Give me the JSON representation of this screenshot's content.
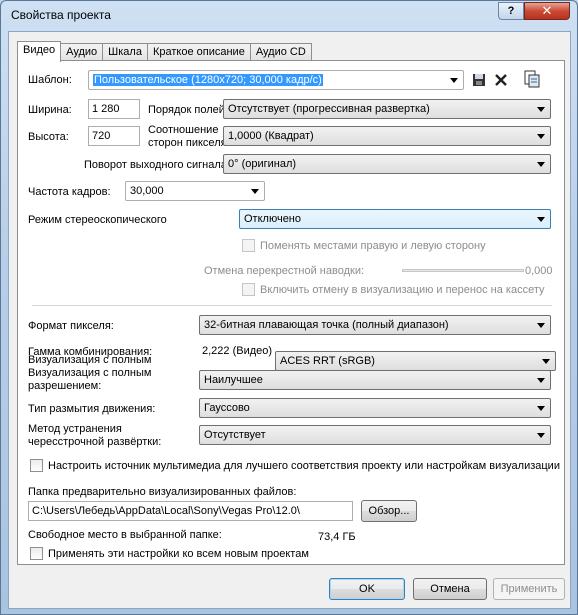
{
  "window": {
    "title": "Свойства проекта",
    "help": "?",
    "close": "✕"
  },
  "tabs": [
    "Видео",
    "Аудио",
    "Шкала",
    "Краткое описание",
    "Аудио CD"
  ],
  "template": {
    "label": "Шаблон:",
    "value": "Пользовательское (1280x720; 30,000 кадр/с)"
  },
  "width": {
    "label": "Ширина:",
    "value": "1 280"
  },
  "height": {
    "label": "Высота:",
    "value": "720"
  },
  "field_order": {
    "label": "Порядок полей:",
    "value": "Отсутствует (прогрессивная развертка)"
  },
  "pixel_aspect": {
    "label1": "Соотношение",
    "label2": "сторон пикселя:",
    "value": "1,0000 (Квадрат)"
  },
  "output_rotation": {
    "label": "Поворот выходного сигнала:",
    "value": "0° (оригинал)"
  },
  "frame_rate": {
    "label": "Частота кадров:",
    "value": "30,000"
  },
  "stereo_mode": {
    "label": "Режим стереоскопического",
    "value": "Отключено"
  },
  "swap_lr": {
    "label": "Поменять местами правую и левую сторону"
  },
  "crosstalk": {
    "label": "Отмена перекрестной наводки:",
    "value": "0,000"
  },
  "crosstalk_render": {
    "label": "Включить отмену в визуализацию и перенос на кассету"
  },
  "pixel_format": {
    "label": "Формат пикселя:",
    "value": "32-битная плавающая точка (полный диапазон)"
  },
  "compositing_gamma": {
    "label": "Гамма комбинирования:",
    "value": "2,222 (Видео)"
  },
  "view_transform": {
    "label": "Визуализация с полным",
    "value": "ACES RRT (sRGB)"
  },
  "render_quality": {
    "label1": "Визуализация с полным",
    "label2": "разрешением:",
    "value": "Наилучшее"
  },
  "motion_blur": {
    "label": "Тип размытия движения:",
    "value": "Гауссово"
  },
  "deinterlace": {
    "label1": "Метод устранения",
    "label2": "чересстрочной развёртки:",
    "value": "Отсутствует"
  },
  "adjust_media": {
    "label": "Настроить источник мультимедиа для лучшего соответствия проекту или настройкам визуализации"
  },
  "prerender_folder": {
    "label": "Папка предварительно визуализированных файлов:",
    "value": "C:\\Users\\Лебедь\\AppData\\Local\\Sony\\Vegas Pro\\12.0\\",
    "browse": "Обзор..."
  },
  "free_space": {
    "label": "Свободное место в выбранной папке:",
    "value": "73,4 ГБ"
  },
  "apply_all": {
    "label": "Применять эти настройки ко всем новым проектам"
  },
  "buttons": {
    "ok": "OK",
    "cancel": "Отмена",
    "apply": "Применить"
  },
  "colors": {
    "selection": "#3399ff",
    "close_button": "#c8452f",
    "focus_border": "#3c7fb1"
  }
}
